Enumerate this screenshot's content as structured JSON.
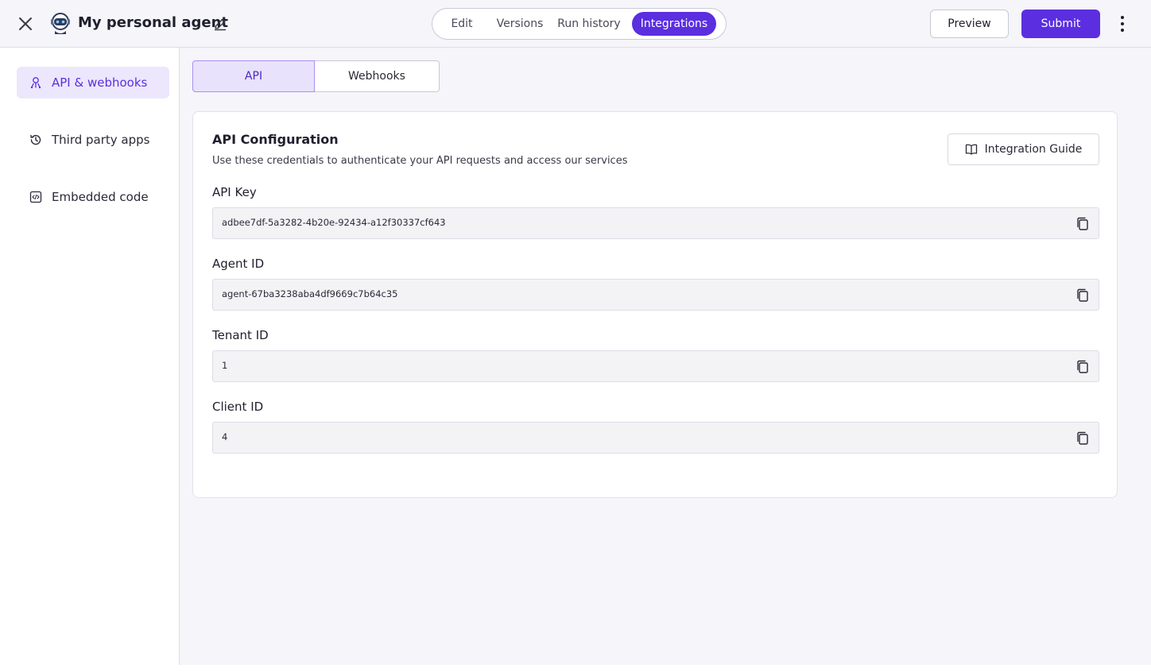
{
  "header": {
    "title": "My personal agent",
    "tabs": [
      {
        "label": "Edit"
      },
      {
        "label": "Versions"
      },
      {
        "label": "Run history"
      },
      {
        "label": "Integrations"
      }
    ],
    "preview_label": "Preview",
    "submit_label": "Submit",
    "active_tab": "Integrations",
    "accent_color": "#5b2ee0"
  },
  "sidebar": {
    "items": [
      {
        "label": "API & webhooks",
        "icon": "api-icon",
        "active": true
      },
      {
        "label": "Third party apps",
        "icon": "history-icon",
        "active": false
      },
      {
        "label": "Embedded code",
        "icon": "code-icon",
        "active": false
      }
    ]
  },
  "main": {
    "segments": [
      {
        "label": "API",
        "active": true
      },
      {
        "label": "Webhooks",
        "active": false
      }
    ],
    "card": {
      "title": "API Configuration",
      "subtitle": "Use these credentials to authenticate your API requests and access our services",
      "guide_label": "Integration Guide",
      "fields": [
        {
          "label": "API Key",
          "value": "adbee7df-5a3282-4b20e-92434-a12f30337cf643"
        },
        {
          "label": "Agent ID",
          "value": "agent-67ba3238aba4df9669c7b64c35"
        },
        {
          "label": "Tenant ID",
          "value": "1"
        },
        {
          "label": "Client ID",
          "value": "4"
        }
      ]
    }
  }
}
